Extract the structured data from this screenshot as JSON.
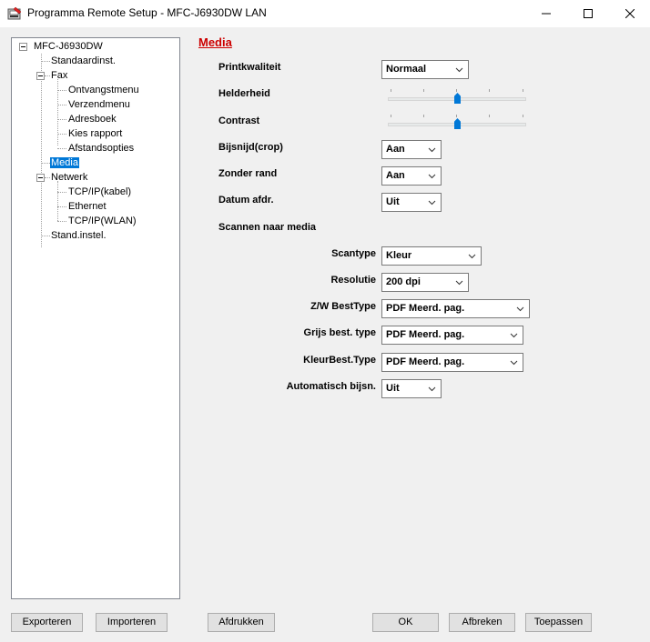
{
  "window": {
    "title": "Programma Remote Setup - MFC-J6930DW LAN",
    "controls": [
      "minimize-icon",
      "maximize-icon",
      "close-icon"
    ]
  },
  "tree": {
    "root": "MFC-J6930DW",
    "items": [
      {
        "label": "Standaardinst."
      },
      {
        "label": "Fax"
      },
      {
        "label": "Ontvangstmenu"
      },
      {
        "label": "Verzendmenu"
      },
      {
        "label": "Adresboek"
      },
      {
        "label": "Kies rapport"
      },
      {
        "label": "Afstandsopties"
      },
      {
        "label": "Media",
        "selected": true
      },
      {
        "label": "Netwerk"
      },
      {
        "label": "TCP/IP(kabel)"
      },
      {
        "label": "Ethernet"
      },
      {
        "label": "TCP/IP(WLAN)"
      },
      {
        "label": "Stand.instel."
      }
    ]
  },
  "panel": {
    "title": "Media",
    "printkwaliteit": {
      "label": "Printkwaliteit",
      "value": "Normaal"
    },
    "helderheid": {
      "label": "Helderheid",
      "level": 0.5
    },
    "contrast": {
      "label": "Contrast",
      "level": 0.5
    },
    "bijsnijden": {
      "label": "Bijsnijd(crop)",
      "value": "Aan"
    },
    "zonder_rand": {
      "label": "Zonder rand",
      "value": "Aan"
    },
    "datum": {
      "label": "Datum afdr.",
      "value": "Uit"
    },
    "scannen_header": "Scannen naar media",
    "scantype": {
      "label": "Scantype",
      "value": "Kleur"
    },
    "resolutie": {
      "label": "Resolutie",
      "value": "200 dpi"
    },
    "zw_besttype": {
      "label": "Z/W BestType",
      "value": "PDF Meerd. pag."
    },
    "grijs_besttype": {
      "label": "Grijs best. type",
      "value": "PDF Meerd. pag."
    },
    "kleur_besttype": {
      "label": "KleurBest.Type",
      "value": "PDF Meerd. pag."
    },
    "auto_bijsn": {
      "label": "Automatisch bijsn.",
      "value": "Uit"
    }
  },
  "buttons": {
    "exporteren": "Exporteren",
    "importeren": "Importeren",
    "afdrukken": "Afdrukken",
    "ok": "OK",
    "afbreken": "Afbreken",
    "toepassen": "Toepassen"
  }
}
